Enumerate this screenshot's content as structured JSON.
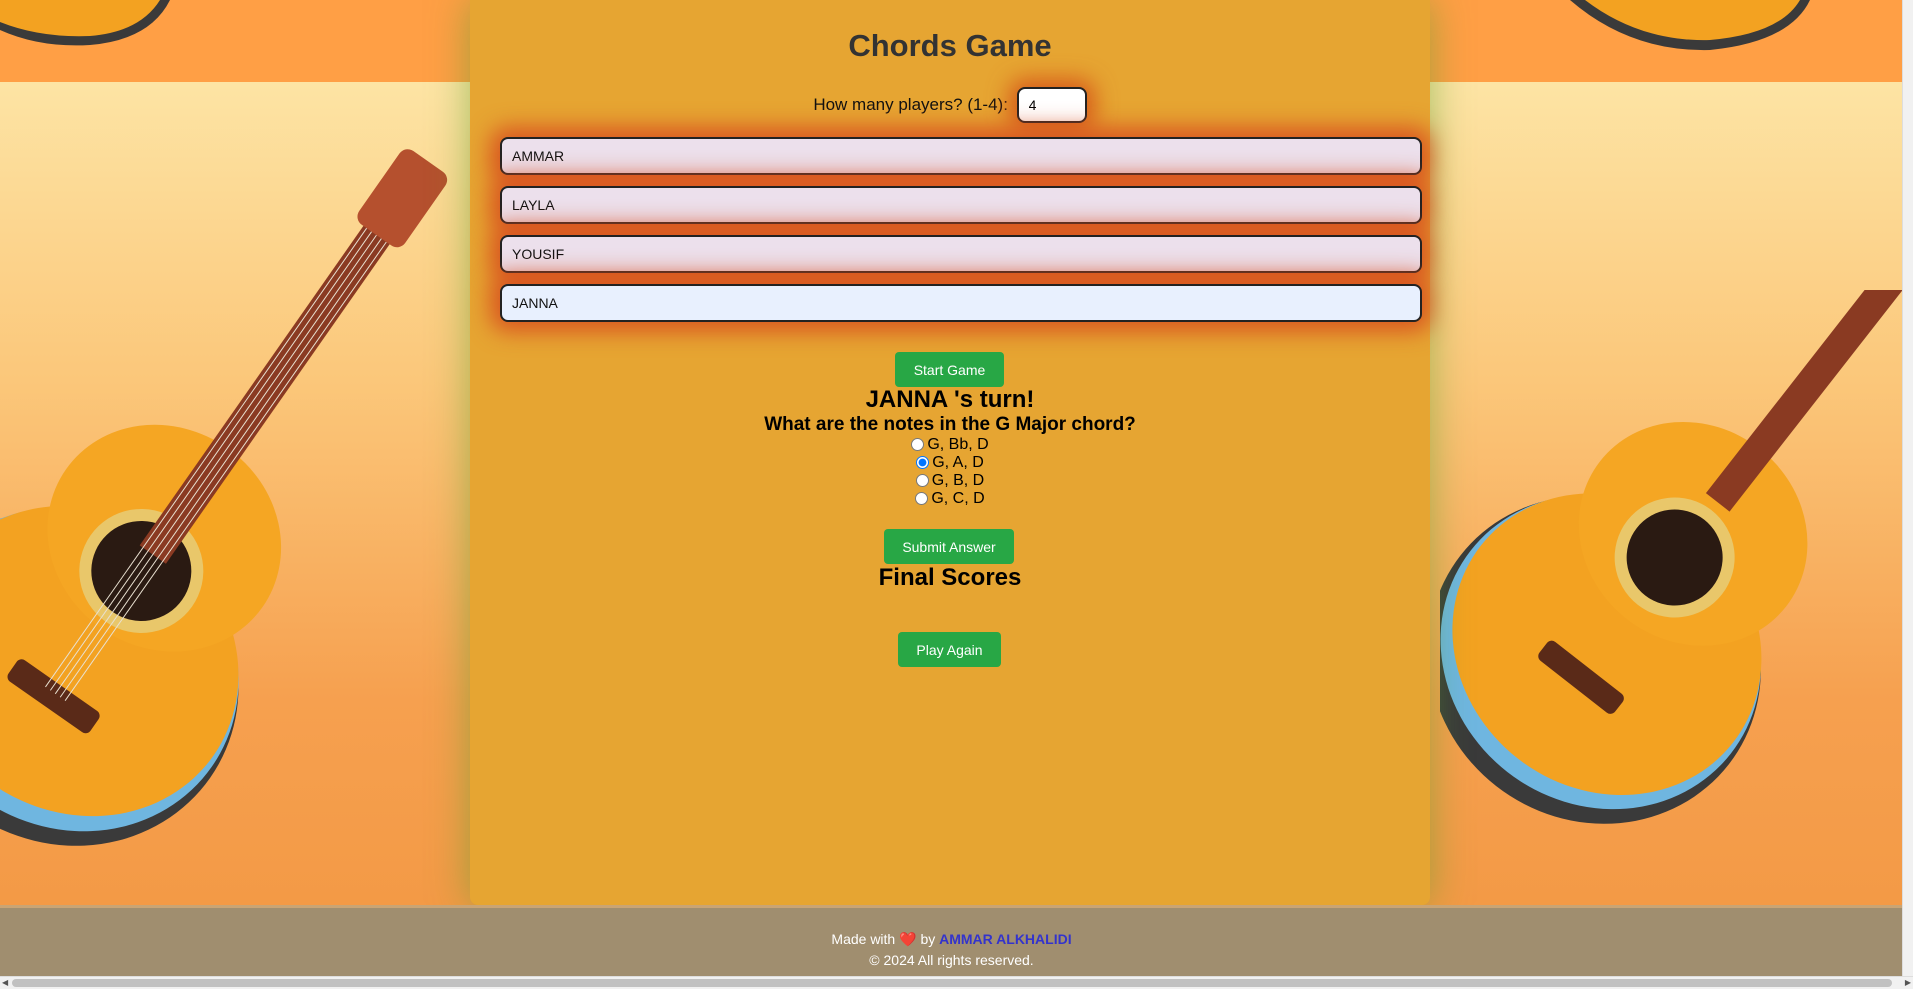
{
  "game": {
    "title": "Chords Game",
    "players_label": "How many players? (1-4):",
    "players_count": "4",
    "player_names": [
      "AMMAR",
      "LAYLA",
      "YOUSIF",
      "JANNA"
    ],
    "start_button": "Start Game",
    "turn_text": "JANNA 's turn!",
    "question": "What are the notes in the G Major chord?",
    "options": [
      "G, Bb, D",
      "G, A, D",
      "G, B, D",
      "G, C, D"
    ],
    "selected_option_index": 1,
    "submit_button": "Submit Answer",
    "final_scores_title": "Final Scores",
    "play_again_button": "Play Again"
  },
  "footer": {
    "made_with": "Made with",
    "heart": "❤️",
    "by": "by",
    "author": "AMMAR ALKHALIDI",
    "copyright": "© 2024 All rights reserved."
  },
  "colors": {
    "panel": "#e6a532",
    "button": "#28a745",
    "footer": "#a08e6f",
    "author_link": "#3333cc"
  }
}
